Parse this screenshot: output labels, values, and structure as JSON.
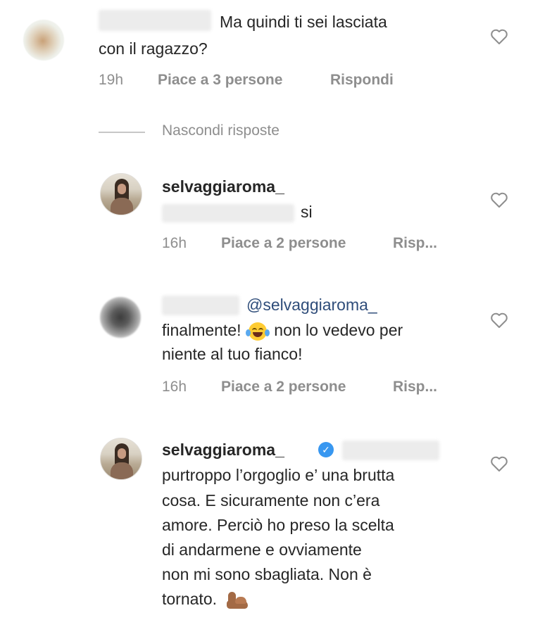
{
  "comments": [
    {
      "text": "Ma quindi ti sei lasciata",
      "text_line2": "con il ragazzo?",
      "time": "19h",
      "likes": "Piace a 3 persone",
      "reply": "Rispondi"
    }
  ],
  "hide_replies": "Nascondi risposte",
  "replies": [
    {
      "username": "selvaggiaroma_",
      "text": "si",
      "time": "16h",
      "likes": "Piace a 2 persone",
      "reply": "Risp..."
    },
    {
      "mention": "@selvaggiaroma_",
      "text_line1_a": "finalmente!",
      "text_line1_b": "non lo vedevo per",
      "text_line2": "niente al tuo fianco!",
      "time": "16h",
      "likes": "Piace a 2 persone",
      "reply": "Risp..."
    },
    {
      "username": "selvaggiaroma_",
      "verified": true,
      "lines": [
        "purtroppo l’orgoglio e’ una brutta",
        "cosa. E sicuramente non c’era",
        "amore. Perciò ho preso la scelta",
        "di andarmene e ovviamente",
        "non mi sono sbagliata. Non è",
        "tornato."
      ]
    }
  ],
  "icons": {
    "like": "heart-outline-icon",
    "verified": "verified-badge-icon",
    "emoji_laugh": "face-with-tears-of-joy-emoji",
    "emoji_muscle": "flexed-biceps-emoji"
  },
  "colors": {
    "text": "#262626",
    "meta": "#8e8e8e",
    "mention": "#2f4d7a",
    "verified": "#3897f0"
  }
}
